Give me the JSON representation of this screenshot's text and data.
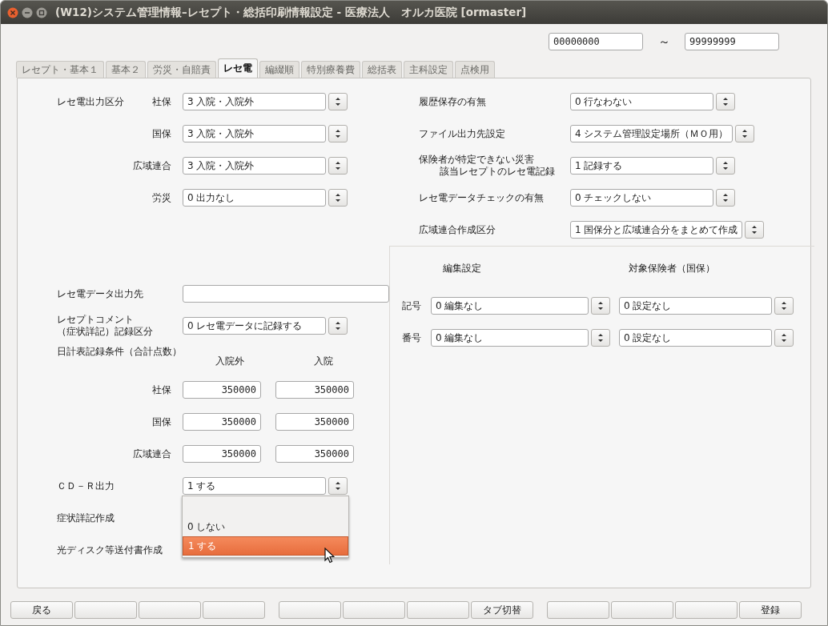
{
  "window": {
    "title": "(W12)システム管理情報–レセプト・総括印刷情報設定 - 医療法人　オルカ医院 [ormaster]"
  },
  "range": {
    "from": "00000000",
    "separator": "～",
    "to": "99999999"
  },
  "tabs": [
    {
      "label": "レセプト・基本１",
      "selected": false
    },
    {
      "label": "基本２",
      "selected": false
    },
    {
      "label": "労災・自賠責",
      "selected": false
    },
    {
      "label": "レセ電",
      "selected": true
    },
    {
      "label": "編綴順",
      "selected": false
    },
    {
      "label": "特別療養費",
      "selected": false
    },
    {
      "label": "総括表",
      "selected": false
    },
    {
      "label": "主科設定",
      "selected": false
    },
    {
      "label": "点検用",
      "selected": false
    }
  ],
  "reseden_output": {
    "label": "レセ電出力区分",
    "rows": [
      {
        "label": "社保",
        "value": "3 入院・入院外"
      },
      {
        "label": "国保",
        "value": "3 入院・入院外"
      },
      {
        "label": "広域連合",
        "value": "3 入院・入院外"
      },
      {
        "label": "労災",
        "value": "0 出力なし"
      }
    ]
  },
  "output_destination": {
    "label": "レセ電データ出力先"
  },
  "comment_record": {
    "label_lines": [
      "レセプトコメント",
      "（症状詳記）記録区分"
    ],
    "value": "0 レセ電データに記録する"
  },
  "daily_table": {
    "label": "日計表記録条件（合計点数）",
    "columns": [
      "入院外",
      "入院"
    ],
    "rows": [
      {
        "label": "社保",
        "values": [
          "350000",
          "350000"
        ]
      },
      {
        "label": "国保",
        "values": [
          "350000",
          "350000"
        ]
      },
      {
        "label": "広域連合",
        "values": [
          "350000",
          "350000"
        ]
      }
    ]
  },
  "cdr_output": {
    "label": "ＣＤ－Ｒ出力",
    "value": "1 する",
    "expanded": true,
    "options": [
      {
        "label": "0 しない",
        "selected": false
      },
      {
        "label": "1 する",
        "selected": true
      }
    ]
  },
  "symptom_detail": {
    "label": "症状詳記作成"
  },
  "optical_disc_letter": {
    "label": "光ディスク等送付書作成"
  },
  "right_settings": [
    {
      "label_lines": [
        "履歴保存の有無"
      ],
      "value": "0 行なわない"
    },
    {
      "label_lines": [
        "ファイル出力先設定"
      ],
      "value": "4 システム管理設定場所（ＭＯ用）"
    },
    {
      "label_lines": [
        "保険者が特定できない災害",
        "該当レセプトのレセ電記録"
      ],
      "value": "1 記録する"
    },
    {
      "label_lines": [
        "レセ電データチェックの有無"
      ],
      "value": "0 チェックしない"
    },
    {
      "label_lines": [
        "広域連合作成区分"
      ],
      "value": "1 国保分と広域連合分をまとめて作成"
    }
  ],
  "edit_section": {
    "columns": [
      "編集設定",
      "対象保険者（国保）"
    ],
    "rows": [
      {
        "label": "記号",
        "values": [
          "0 編集なし",
          "0 設定なし"
        ]
      },
      {
        "label": "番号",
        "values": [
          "0 編集なし",
          "0 設定なし"
        ]
      }
    ]
  },
  "function_keys": [
    {
      "kind": "labeled",
      "label": "戻る"
    },
    {
      "kind": "blank"
    },
    {
      "kind": "blank"
    },
    {
      "kind": "blank"
    },
    {
      "kind": "blank"
    },
    {
      "kind": "blank"
    },
    {
      "kind": "blank"
    },
    {
      "kind": "labeled",
      "label": "タブ切替"
    },
    {
      "kind": "blank"
    },
    {
      "kind": "blank"
    },
    {
      "kind": "blank"
    },
    {
      "kind": "labeled",
      "label": "登録"
    }
  ]
}
